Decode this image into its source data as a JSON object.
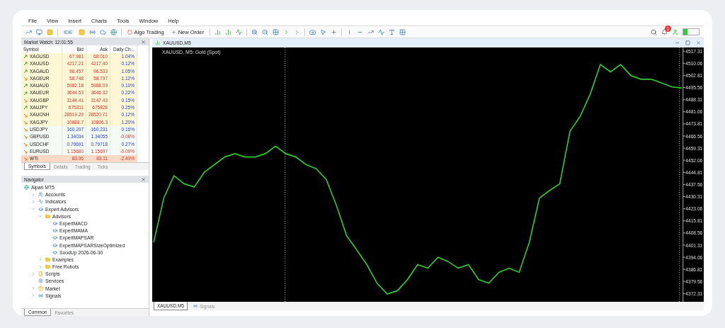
{
  "menu": [
    "File",
    "View",
    "Insert",
    "Charts",
    "Tools",
    "Window",
    "Help"
  ],
  "toolbar": {
    "ide_label": "IDE",
    "algo_trading": {
      "label": "Algo Trading",
      "on": false
    },
    "new_order": "New Order",
    "notifications": "1"
  },
  "market_watch": {
    "title": "Market Watch: 12:01:55",
    "columns": [
      "Symbol",
      "Bid",
      "Ask",
      "Daily Ch..."
    ],
    "rows": [
      {
        "symbol": "XAGUSD",
        "bid": "67.981",
        "ask": "68.010",
        "change": "1.04%",
        "rising": true,
        "tick_up": false,
        "kind": "metal"
      },
      {
        "symbol": "XAUUSD",
        "bid": "4217.21",
        "ask": "4217.40",
        "change": "0.12%",
        "rising": true,
        "tick_up": false,
        "kind": "metal"
      },
      {
        "symbol": "XAGAUD",
        "bid": "96.457",
        "ask": "96.533",
        "change": "1.05%",
        "rising": true,
        "tick_up": false,
        "kind": "metal"
      },
      {
        "symbol": "XAGEUR",
        "bid": "58.748",
        "ask": "58.797",
        "change": "1.12%",
        "rising": false,
        "tick_up": false,
        "kind": "metal"
      },
      {
        "symbol": "XAUAUD",
        "bid": "5982.18",
        "ask": "5988.09",
        "change": "0.10%",
        "rising": true,
        "tick_up": false,
        "kind": "metal"
      },
      {
        "symbol": "XAUEUR",
        "bid": "3644.53",
        "ask": "3646.32",
        "change": "0.22%",
        "rising": true,
        "tick_up": false,
        "kind": "metal"
      },
      {
        "symbol": "XAUGBP",
        "bid": "3144.41",
        "ask": "3147.43",
        "change": "0.15%",
        "rising": false,
        "tick_up": false,
        "kind": "metal"
      },
      {
        "symbol": "XAUJPY",
        "bid": "675311",
        "ask": "675828",
        "change": "0.25%",
        "rising": true,
        "tick_up": false,
        "kind": "metal"
      },
      {
        "symbol": "XAUCNH",
        "bid": "28519.29",
        "ask": "28520.71",
        "change": "0.12%",
        "rising": false,
        "tick_up": false,
        "kind": "metal"
      },
      {
        "symbol": "XAGJPY",
        "bid": "10888.7",
        "ask": "10896.3",
        "change": "1.20%",
        "rising": false,
        "tick_up": false,
        "kind": "metal"
      },
      {
        "symbol": "USDJPY",
        "bid": "160.207",
        "ask": "160.231",
        "change": "0.16%",
        "rising": false,
        "tick_up": true,
        "kind": "forex"
      },
      {
        "symbol": "GBPUSD",
        "bid": "1.34034",
        "ask": "1.34055",
        "change": "-0.08%",
        "rising": false,
        "tick_up": true,
        "kind": "forex"
      },
      {
        "symbol": "USDCHF",
        "bid": "0.79691",
        "ask": "0.79718",
        "change": "0.27%",
        "rising": false,
        "tick_up": true,
        "kind": "forex"
      },
      {
        "symbol": "EURUSD",
        "bid": "1.15680",
        "ask": "1.15697",
        "change": "-0.09%",
        "rising": false,
        "tick_up": false,
        "kind": "forex"
      },
      {
        "symbol": "WTI",
        "bid": "83.06",
        "ask": "83.11",
        "change": "-2.49%",
        "rising": false,
        "tick_up": false,
        "kind": "commodity"
      }
    ],
    "tabs": [
      {
        "label": "Symbols",
        "selected": true
      },
      {
        "label": "Details",
        "selected": false
      },
      {
        "label": "Trading",
        "selected": false
      },
      {
        "label": "Ticks",
        "selected": false
      }
    ]
  },
  "navigator": {
    "title": "Navigator",
    "tree": [
      {
        "label": "Alpari MT5",
        "kind": "root",
        "children": [
          {
            "label": "Accounts",
            "kind": "accounts",
            "expanded": false
          },
          {
            "label": "Indicators",
            "kind": "indicators",
            "expanded": false
          },
          {
            "label": "Expert Advisors",
            "kind": "experts",
            "expanded": true,
            "children": [
              {
                "label": "Advisors",
                "kind": "folder",
                "expanded": true,
                "children": [
                  {
                    "label": "ExpertMACD",
                    "kind": "expert"
                  },
                  {
                    "label": "ExpertMAMA",
                    "kind": "expert"
                  },
                  {
                    "label": "ExpertMAPSAR",
                    "kind": "expert"
                  },
                  {
                    "label": "ExpertMAPSARSizeOptimized",
                    "kind": "expert"
                  },
                  {
                    "label": "SoodUp 2026-06-30",
                    "kind": "expert"
                  }
                ]
              },
              {
                "label": "Examples",
                "kind": "folder",
                "expanded": false
              },
              {
                "label": "Free Robots",
                "kind": "folder",
                "expanded": false
              }
            ]
          },
          {
            "label": "Scripts",
            "kind": "scripts",
            "expanded": false
          },
          {
            "label": "Services",
            "kind": "services"
          },
          {
            "label": "Market",
            "kind": "market",
            "expanded": false
          },
          {
            "label": "Signals",
            "kind": "signals",
            "expanded": false
          }
        ]
      }
    ],
    "tabs": [
      {
        "label": "Common",
        "selected": true
      },
      {
        "label": "Favorites",
        "selected": false
      }
    ]
  },
  "chart_window": {
    "title": "XAUUSD,M5",
    "chart_label": "XAUUSD, M5:  Gold (Spot)",
    "chart_data": {
      "type": "line",
      "ylim": [
        4367.4,
        4519.5
      ],
      "yticks": [
        4517.31,
        4510.06,
        4502.81,
        4495.56,
        4488.31,
        4481.06,
        4473.81,
        4466.56,
        4459.31,
        4452.06,
        4444.81,
        4437.56,
        4430.31,
        4423.06,
        4415.81,
        4408.56,
        4401.31,
        4394.06,
        4386.81,
        4379.56,
        4372.31
      ],
      "series": [
        {
          "color": "#2ecc2e",
          "values": [
            4402.9,
            4429.5,
            4442.8,
            4438,
            4436,
            4445,
            4449.5,
            4454,
            4456,
            4454,
            4454,
            4456,
            4460.5,
            4456,
            4454,
            4449.5,
            4447,
            4440.6,
            4425,
            4407,
            4398.5,
            4389.6,
            4378.5,
            4372,
            4374,
            4380.7,
            4389.6,
            4387.5,
            4394,
            4391.5,
            4387.5,
            4389.6,
            4380.7,
            4378.5,
            4385,
            4387.5,
            4385,
            4403,
            4429.5,
            4434,
            4438,
            4469.4,
            4478.3,
            4491.6,
            4509.3,
            4504.9,
            4509.3,
            4502.7,
            4500.5,
            4500.5,
            4498.3,
            4496,
            4495.2
          ]
        }
      ]
    },
    "tabs": [
      {
        "label": "XAUUSD,M5",
        "selected": true,
        "kind": "chart"
      },
      {
        "label": "Signals",
        "selected": false,
        "kind": "signals"
      }
    ]
  }
}
